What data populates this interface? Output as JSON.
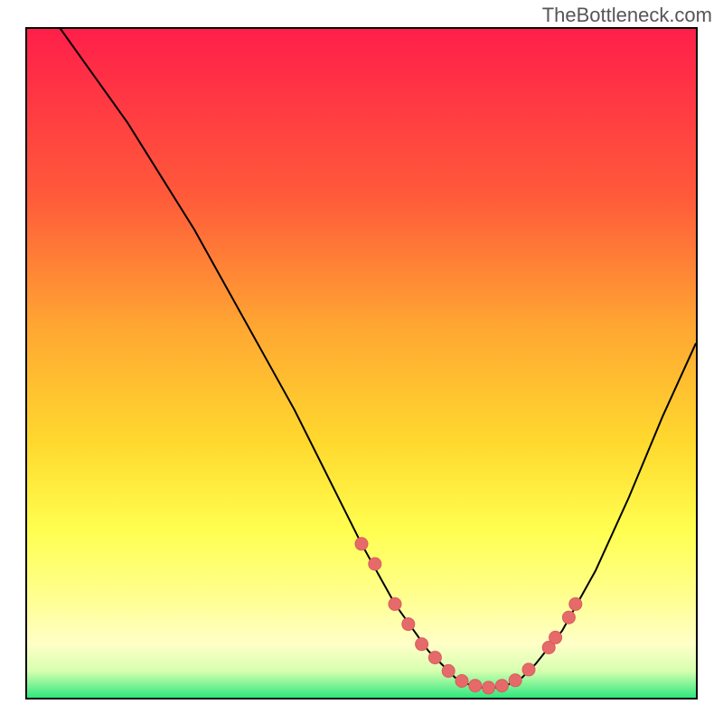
{
  "watermark": "TheBottleneck.com",
  "colors": {
    "gradient_top": "#ff1f4a",
    "gradient_mid1": "#ff8d2f",
    "gradient_mid2": "#ffe12e",
    "gradient_yellow_bright": "#ffff60",
    "gradient_yellow_pale": "#ffffa8",
    "gradient_bottom": "#2ee87e",
    "curve": "#000000",
    "marker": "#e76a6a"
  },
  "chart_data": {
    "type": "line",
    "title": "",
    "xlabel": "",
    "ylabel": "",
    "xlim": [
      0,
      100
    ],
    "ylim": [
      0,
      100
    ],
    "grid": false,
    "series": [
      {
        "name": "bottleneck-curve",
        "x": [
          0,
          5,
          10,
          15,
          20,
          25,
          30,
          35,
          40,
          45,
          50,
          55,
          60,
          62,
          64,
          66,
          68,
          70,
          72,
          74,
          76,
          80,
          85,
          90,
          95,
          100
        ],
        "values": [
          106,
          100,
          93,
          86,
          78,
          70,
          61,
          52,
          43,
          33,
          23,
          14,
          7,
          5,
          3,
          2,
          1.5,
          1.5,
          2,
          3,
          5,
          10,
          19,
          30,
          42,
          53
        ]
      }
    ],
    "markers": {
      "name": "highlight-points",
      "x": [
        50,
        52,
        55,
        57,
        59,
        61,
        63,
        65,
        67,
        69,
        71,
        73,
        75,
        78,
        79,
        81,
        82
      ],
      "values": [
        23,
        20,
        14,
        11,
        8,
        6,
        4,
        2.5,
        1.8,
        1.5,
        1.8,
        2.6,
        4.2,
        7.5,
        9,
        12,
        14
      ]
    }
  }
}
